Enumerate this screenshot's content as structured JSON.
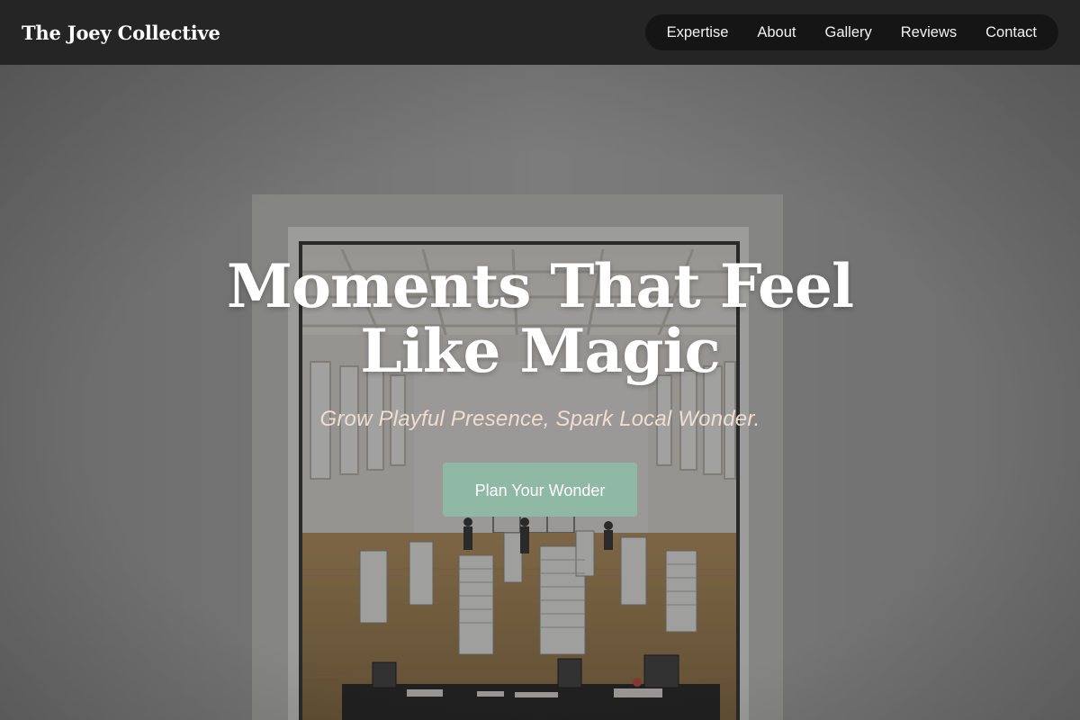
{
  "header": {
    "brand": "The Joey Collective",
    "nav": [
      {
        "label": "Expertise"
      },
      {
        "label": "About"
      },
      {
        "label": "Gallery"
      },
      {
        "label": "Reviews"
      },
      {
        "label": "Contact"
      }
    ]
  },
  "hero": {
    "title_line1": "Moments That Feel",
    "title_line2": "Like Magic",
    "subtitle": "Grow Playful Presence, Spark Local Wonder.",
    "cta_label": "Plan Your Wonder"
  },
  "colors": {
    "header_bg": "#252525",
    "nav_pill_bg": "#151515",
    "cta_bg": "#8fb8a5",
    "subtitle_color": "#f0ddd0"
  }
}
